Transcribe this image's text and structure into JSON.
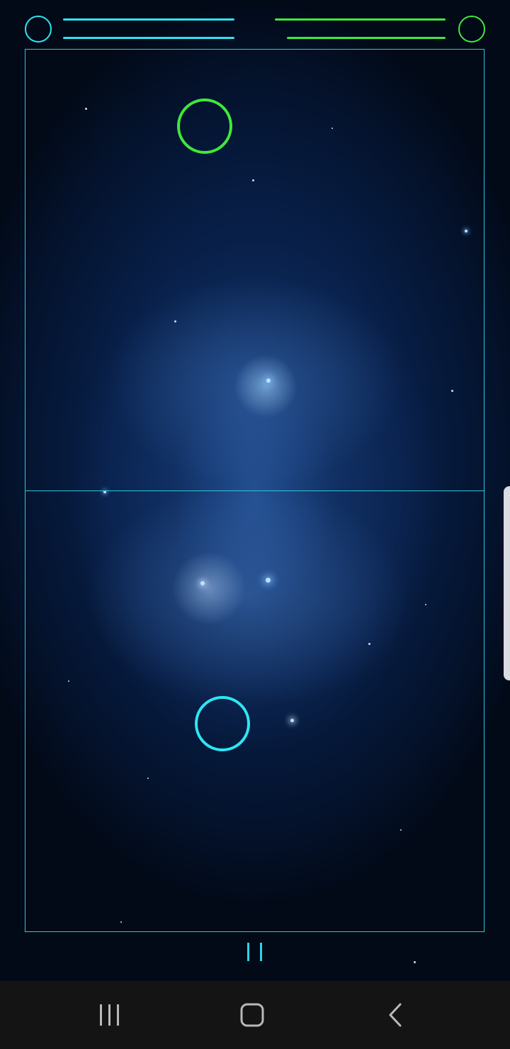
{
  "colors": {
    "player1": "#2ce6f2",
    "player2": "#3fe83a",
    "field_line": "#2fc7d8",
    "pause": "#29d4e8",
    "nav_icons": "#b9b9b9",
    "nav_background": "#141414"
  },
  "hud": {
    "player1": {
      "icon": "player1-indicator-circle",
      "bars": 2
    },
    "player2": {
      "icon": "player2-indicator-circle",
      "bars": 2
    }
  },
  "field": {
    "player2_paddle": "green-ring",
    "player1_paddle": "cyan-ring"
  },
  "controls": {
    "pause_icon": "pause-icon"
  },
  "navigation": {
    "recent_apps_icon": "recent-apps-icon",
    "home_icon": "home-icon",
    "back_icon": "back-icon"
  }
}
